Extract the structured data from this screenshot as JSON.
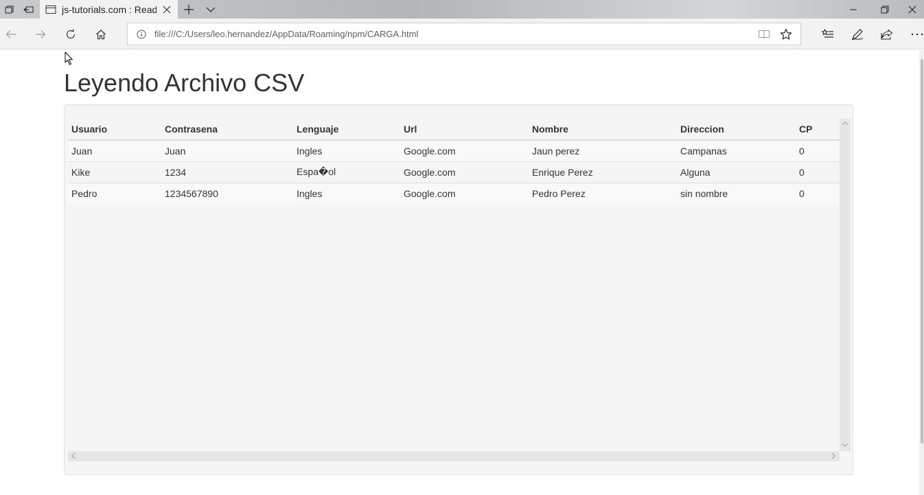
{
  "browser": {
    "tab_title": "js-tutorials.com : Readir",
    "address": "file:///C:/Users/leo.hernandez/AppData/Roaming/npm/CARGA.html"
  },
  "page": {
    "title": "Leyendo Archivo CSV"
  },
  "table": {
    "headers": [
      "Usuario",
      "Contrasena",
      "Lenguaje",
      "Url",
      "Nombre",
      "Direccion",
      "CP"
    ],
    "rows": [
      [
        "Juan",
        "Juan",
        "Ingles",
        "Google.com",
        "Jaun perez",
        "Campanas",
        "0"
      ],
      [
        "Kike",
        "1234",
        "Espa�ol",
        "Google.com",
        "Enrique Perez",
        "Alguna",
        "0"
      ],
      [
        "Pedro",
        "1234567890",
        "Ingles",
        "Google.com",
        "Pedro Perez",
        "sin nombre",
        "0"
      ]
    ]
  },
  "icons": {
    "tab_manager": "tab-manager-icon",
    "set_aside": "set-aside-tabs-icon",
    "page": "page-icon",
    "close": "close-icon",
    "new_tab": "plus-icon",
    "tab_list": "chevron-down-icon",
    "minimize": "minimize-icon",
    "restore": "restore-icon",
    "back": "back-arrow-icon",
    "forward": "forward-arrow-icon",
    "refresh": "refresh-icon",
    "home": "home-icon",
    "info": "info-icon",
    "reading_view": "reading-view-icon",
    "favorite": "star-icon",
    "favorites_hub": "favorites-list-icon",
    "web_note": "pen-icon",
    "share": "share-icon",
    "more": "more-icon"
  }
}
